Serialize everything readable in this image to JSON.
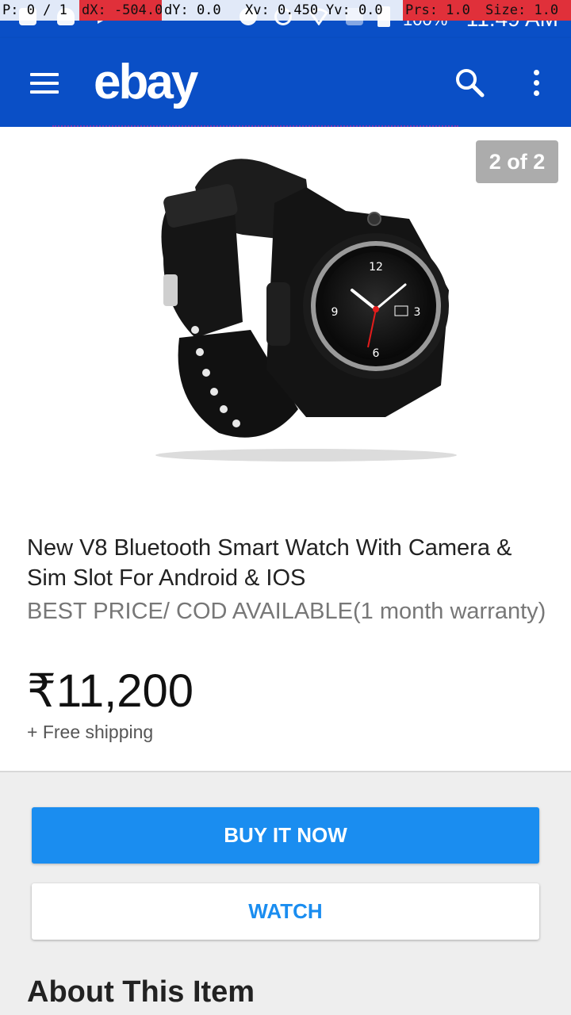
{
  "pointer_overlay": {
    "p": "P: 0 / 1",
    "dx": "dX: -504.0",
    "dy": "dY: 0.0",
    "xv": "Xv: 0.450",
    "yv": "Yv: 0.0",
    "prs": "Prs: 1.0",
    "size": "Size: 1.0"
  },
  "status_bar": {
    "battery": "100%",
    "time": "11:49 AM"
  },
  "app_bar": {
    "logo": "ebay",
    "icons": [
      "menu-icon",
      "search-icon",
      "more-vert-icon"
    ]
  },
  "gallery": {
    "counter": "2 of 2"
  },
  "item": {
    "title": "New V8 Bluetooth Smart Watch With Camera & Sim Slot For Android & IOS",
    "subtitle": "BEST PRICE/ COD AVAILABLE(1 month warranty)",
    "price": "₹11,200",
    "shipping": "+ Free shipping"
  },
  "actions": {
    "buy_label": "BUY IT NOW",
    "watch_label": "WATCH"
  },
  "sections": {
    "about": "About This Item"
  },
  "colors": {
    "brand_blue": "#0a4fc6",
    "button_blue": "#1a8df0"
  }
}
